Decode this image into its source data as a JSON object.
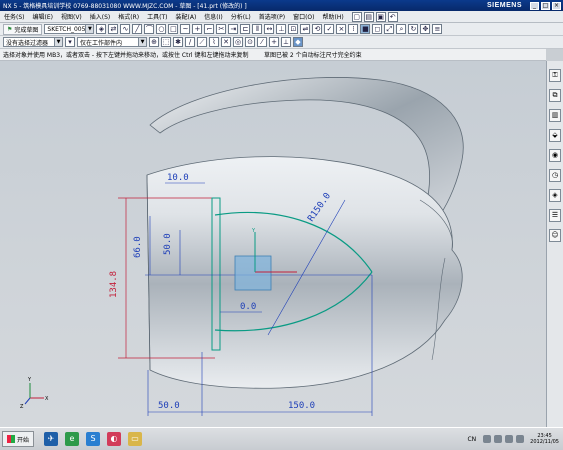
{
  "window": {
    "title": "NX 5 - 筑格模具培训学校  0769-88031080  WWW.MJZC.COM - 草图 - [41.prt (修改的) ]",
    "brand": "SIEMENS",
    "controls": [
      "_",
      "□",
      "×"
    ]
  },
  "menubar": {
    "items": [
      "任务(S)",
      "编辑(E)",
      "视图(V)",
      "插入(S)",
      "格式(R)",
      "工具(T)",
      "装配(A)",
      "信息(I)",
      "分析(L)",
      "首选项(P)",
      "窗口(O)",
      "帮助(H)"
    ]
  },
  "toolbar1": {
    "finish_sketch_label": "完成草图",
    "sketch_name": "SKETCH_005"
  },
  "toolbar2": {
    "selection_filter": "没有选择过滤器",
    "assembly_scope": "仅在工作部件内"
  },
  "cue": {
    "prompt": "选择对象并使用 MB3，或者双击 - 按下左键并拖动来移动，或按住 Ctrl 键和左键拖动来复制",
    "status": "草图已被 2 个自动标注尺寸完全约束"
  },
  "dimensions": {
    "d_top": "10.0",
    "d_66": "66.0",
    "d_50": "50.0",
    "d_r150": "R150.0",
    "d_134": "134.8",
    "d_0": "0.0",
    "d_bottom_left": "50.0",
    "d_bottom_right": "150.0"
  },
  "axes": {
    "x": "X",
    "y": "Y",
    "z": "Z"
  },
  "taskbar": {
    "start_label": "开始",
    "lang": "CN",
    "time": "23:45",
    "date": "2012/11/05"
  },
  "colors": {
    "title_bg": "#0b3a8c",
    "dimension": "#1e3fb8",
    "sketch_curve": "#0a9b84",
    "reference": "#c21f3a",
    "body": "#b9c0c7"
  }
}
